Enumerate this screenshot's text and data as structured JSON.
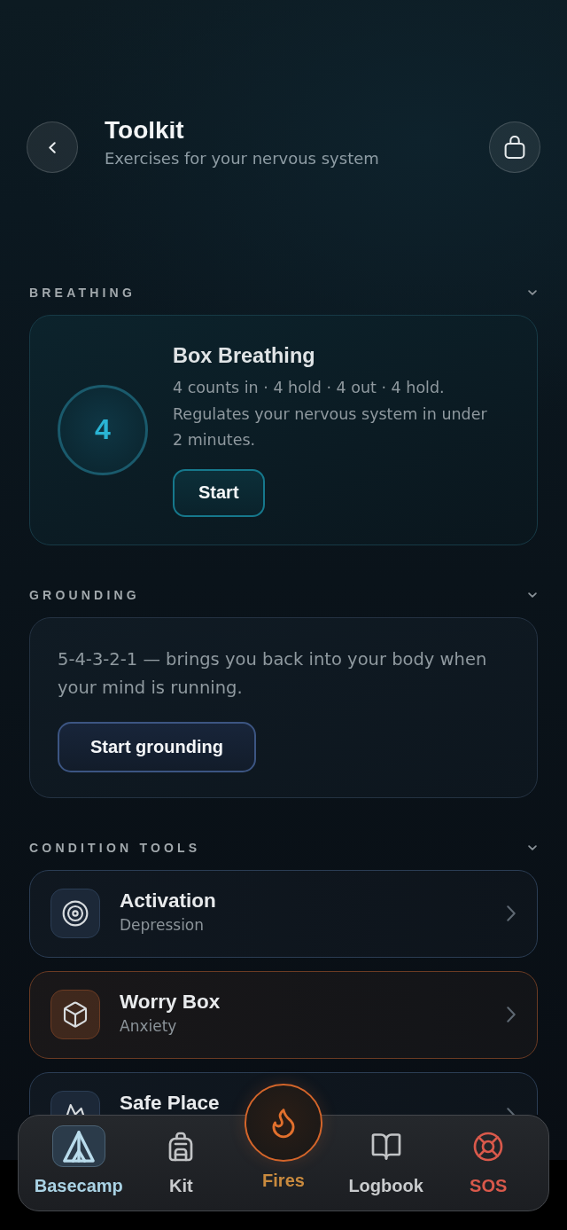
{
  "header": {
    "title": "Toolkit",
    "subtitle": "Exercises for your nervous system"
  },
  "sections": [
    {
      "kind": "breathing",
      "label": "BREATHING",
      "expanded": true,
      "card": {
        "counter": "4",
        "title": "Box Breathing",
        "description": "4 counts in · 4 hold · 4 out · 4 hold. Regulates your nervous system in under 2 minutes.",
        "button": "Start"
      }
    },
    {
      "kind": "grounding",
      "label": "GROUNDING",
      "expanded": true,
      "card": {
        "description": "5-4-3-2-1 — brings you back into your body when your mind is running.",
        "button": "Start grounding"
      }
    },
    {
      "kind": "tools",
      "label": "CONDITION TOOLS",
      "expanded": true,
      "items": [
        {
          "title": "Activation",
          "subtitle": "Depression",
          "color": "#2b3d54"
        },
        {
          "title": "Worry Box",
          "subtitle": "Anxiety",
          "color": "#6b3b23"
        },
        {
          "title": "Safe Place",
          "color": "#2b3d54"
        }
      ]
    }
  ],
  "nav": {
    "items": [
      {
        "label": "Basecamp",
        "kind": "tab",
        "selected": true
      },
      {
        "label": "Kit",
        "kind": "tab",
        "selected": false
      },
      {
        "label": "Fires",
        "kind": "raised",
        "selected": false
      },
      {
        "label": "Logbook",
        "kind": "tab",
        "selected": false
      },
      {
        "label": "SOS",
        "kind": "emergency",
        "selected": false
      }
    ]
  }
}
